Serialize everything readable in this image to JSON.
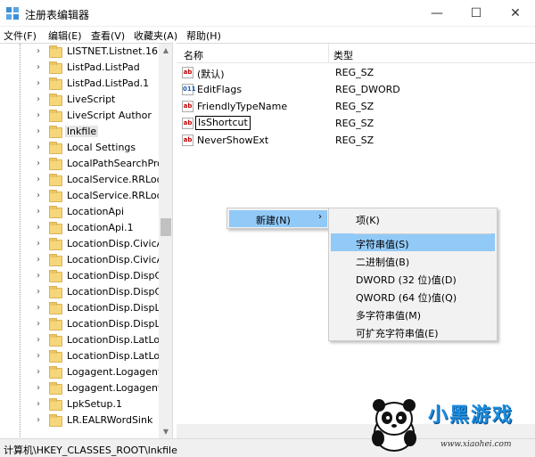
{
  "window": {
    "title": "注册表编辑器",
    "minimize_glyph": "—",
    "maximize_glyph": "☐",
    "close_glyph": "✕"
  },
  "menubar": [
    {
      "label": "文件(F)"
    },
    {
      "label": "编辑(E)"
    },
    {
      "label": "查看(V)"
    },
    {
      "label": "收藏夹(A)"
    },
    {
      "label": "帮助(H)"
    }
  ],
  "tree": {
    "items": [
      {
        "label": "LISTNET.Listnet.16",
        "expander": "›"
      },
      {
        "label": "ListPad.ListPad",
        "expander": "›"
      },
      {
        "label": "ListPad.ListPad.1",
        "expander": "›"
      },
      {
        "label": "LiveScript",
        "expander": "›"
      },
      {
        "label": "LiveScript Author",
        "expander": "›"
      },
      {
        "label": "lnkfile",
        "expander": "›",
        "selected": true
      },
      {
        "label": "Local Settings",
        "expander": "›"
      },
      {
        "label": "LocalPathSearchPro",
        "expander": "›"
      },
      {
        "label": "LocalService.RRLoca",
        "expander": "›"
      },
      {
        "label": "LocalService.RRLoca",
        "expander": "›"
      },
      {
        "label": "LocationApi",
        "expander": "›"
      },
      {
        "label": "LocationApi.1",
        "expander": "›"
      },
      {
        "label": "LocationDisp.CivicA",
        "expander": "›"
      },
      {
        "label": "LocationDisp.CivicA",
        "expander": "›"
      },
      {
        "label": "LocationDisp.DispCi",
        "expander": "›"
      },
      {
        "label": "LocationDisp.DispCi",
        "expander": "›"
      },
      {
        "label": "LocationDisp.DispLa",
        "expander": "›"
      },
      {
        "label": "LocationDisp.DispLa",
        "expander": "›"
      },
      {
        "label": "LocationDisp.LatLon",
        "expander": "›"
      },
      {
        "label": "LocationDisp.LatLon",
        "expander": "›"
      },
      {
        "label": "Logagent.Logagent",
        "expander": "›"
      },
      {
        "label": "Logagent.Logagent",
        "expander": "›"
      },
      {
        "label": "LpkSetup.1",
        "expander": "›"
      },
      {
        "label": "LR.EALRWordSink",
        "expander": "›"
      }
    ]
  },
  "list": {
    "col_name": "名称",
    "col_type": "类型",
    "rows": [
      {
        "icon": "ab",
        "kind": "string-value-icon",
        "name": "(默认)",
        "type": "REG_SZ"
      },
      {
        "icon": "011",
        "kind": "binary-value-icon",
        "name": "EditFlags",
        "type": "REG_DWORD"
      },
      {
        "icon": "ab",
        "kind": "string-value-icon",
        "name": "FriendlyTypeName",
        "type": "REG_SZ"
      },
      {
        "icon": "ab",
        "kind": "string-value-icon",
        "name": "IsShortcut",
        "type": "REG_SZ",
        "editing": true
      },
      {
        "icon": "ab",
        "kind": "string-value-icon",
        "name": "NeverShowExt",
        "type": "REG_SZ"
      }
    ]
  },
  "context_menu": {
    "new_label": "新建(N)",
    "arrow": "›",
    "submenu": [
      {
        "label": "项(K)"
      },
      {
        "label": "字符串值(S)",
        "highlighted": true
      },
      {
        "label": "二进制值(B)"
      },
      {
        "label": "DWORD (32 位)值(D)"
      },
      {
        "label": "QWORD (64 位)值(Q)"
      },
      {
        "label": "多字符串值(M)"
      },
      {
        "label": "可扩充字符串值(E)"
      }
    ]
  },
  "statusbar": {
    "path": "计算机\\HKEY_CLASSES_ROOT\\lnkfile"
  },
  "watermark": {
    "text": "小黑游戏",
    "url": "www.xiaohei.com"
  },
  "colors": {
    "highlight": "#91c9f7",
    "menu_bg": "#f2f2f2",
    "folder": "#f6d67a"
  }
}
